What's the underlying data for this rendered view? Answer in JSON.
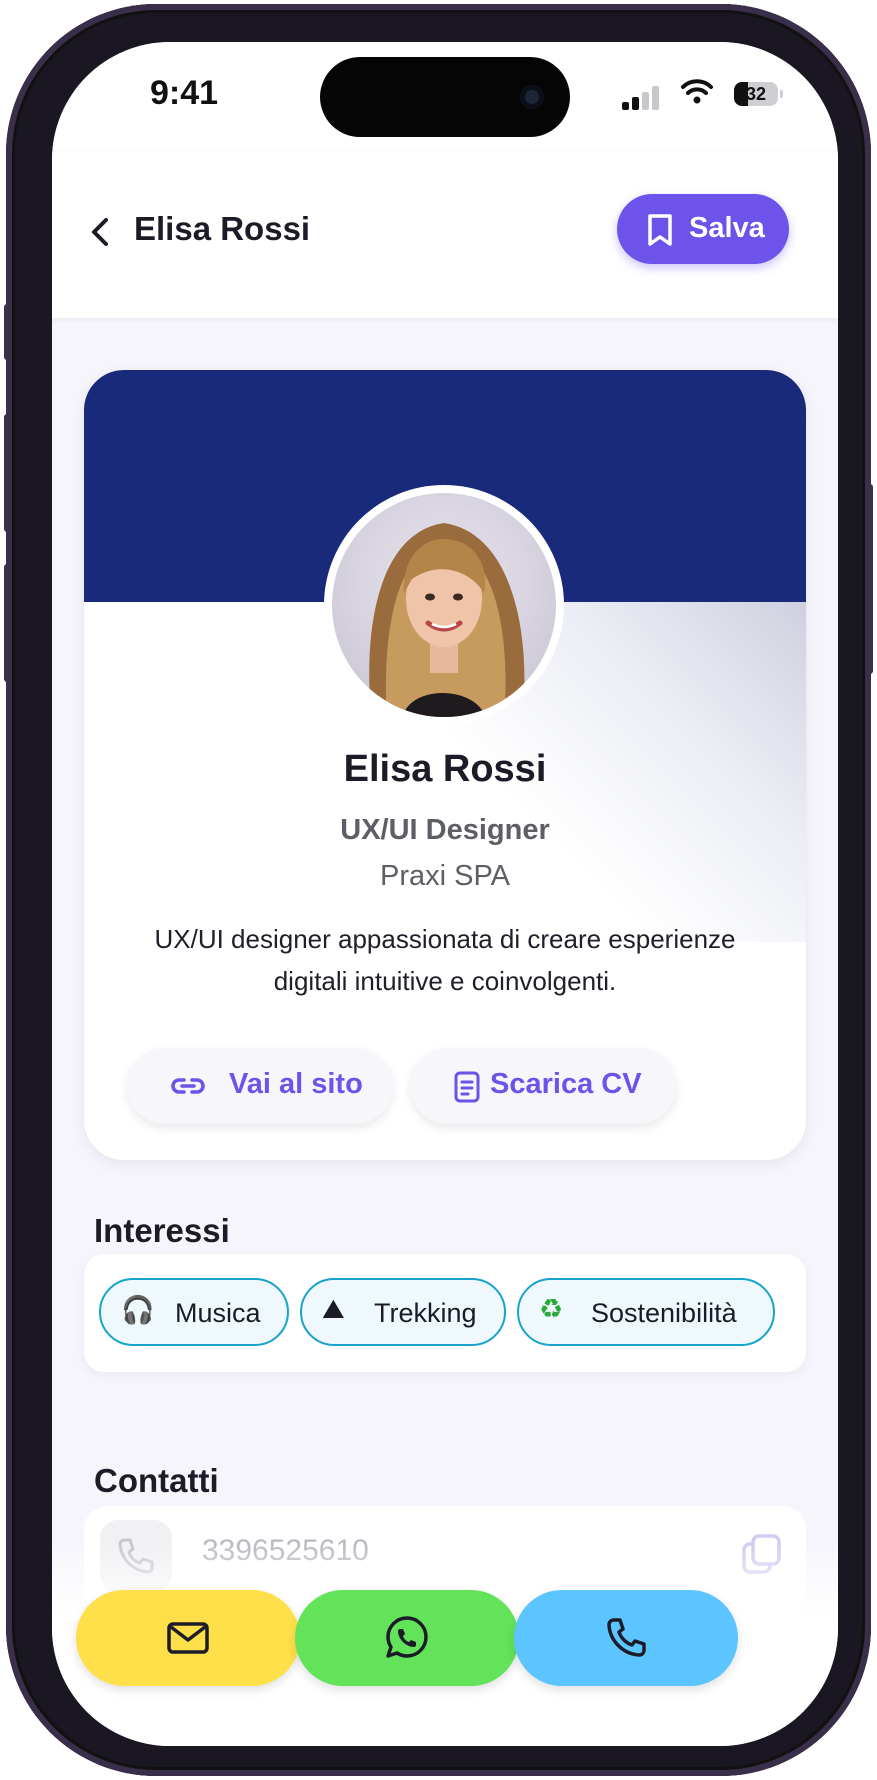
{
  "status_bar": {
    "time": "9:41",
    "battery": "32"
  },
  "header": {
    "title": "Elisa Rossi",
    "save_label": "Salva"
  },
  "profile": {
    "name": "Elisa Rossi",
    "role": "UX/UI Designer",
    "company": "Praxi SPA",
    "bio": "UX/UI designer appassionata di creare esperienze digitali intuitive e coinvolgenti.",
    "website_label": "Vai al sito",
    "cv_label": "Scarica CV"
  },
  "interests": {
    "title": "Interessi",
    "items": [
      {
        "emoji": "🎧",
        "label": "Musica"
      },
      {
        "emoji": "⛰",
        "label": "Trekking"
      },
      {
        "emoji": "♻",
        "label": "Sostenibilità"
      }
    ]
  },
  "contacts": {
    "title": "Contatti",
    "phone": "3396525610"
  },
  "colors": {
    "accent": "#6d53ea",
    "banner": "#1a2a7a",
    "email": "#ffe04a",
    "whatsapp": "#62e35a",
    "call": "#5cc4ff"
  }
}
